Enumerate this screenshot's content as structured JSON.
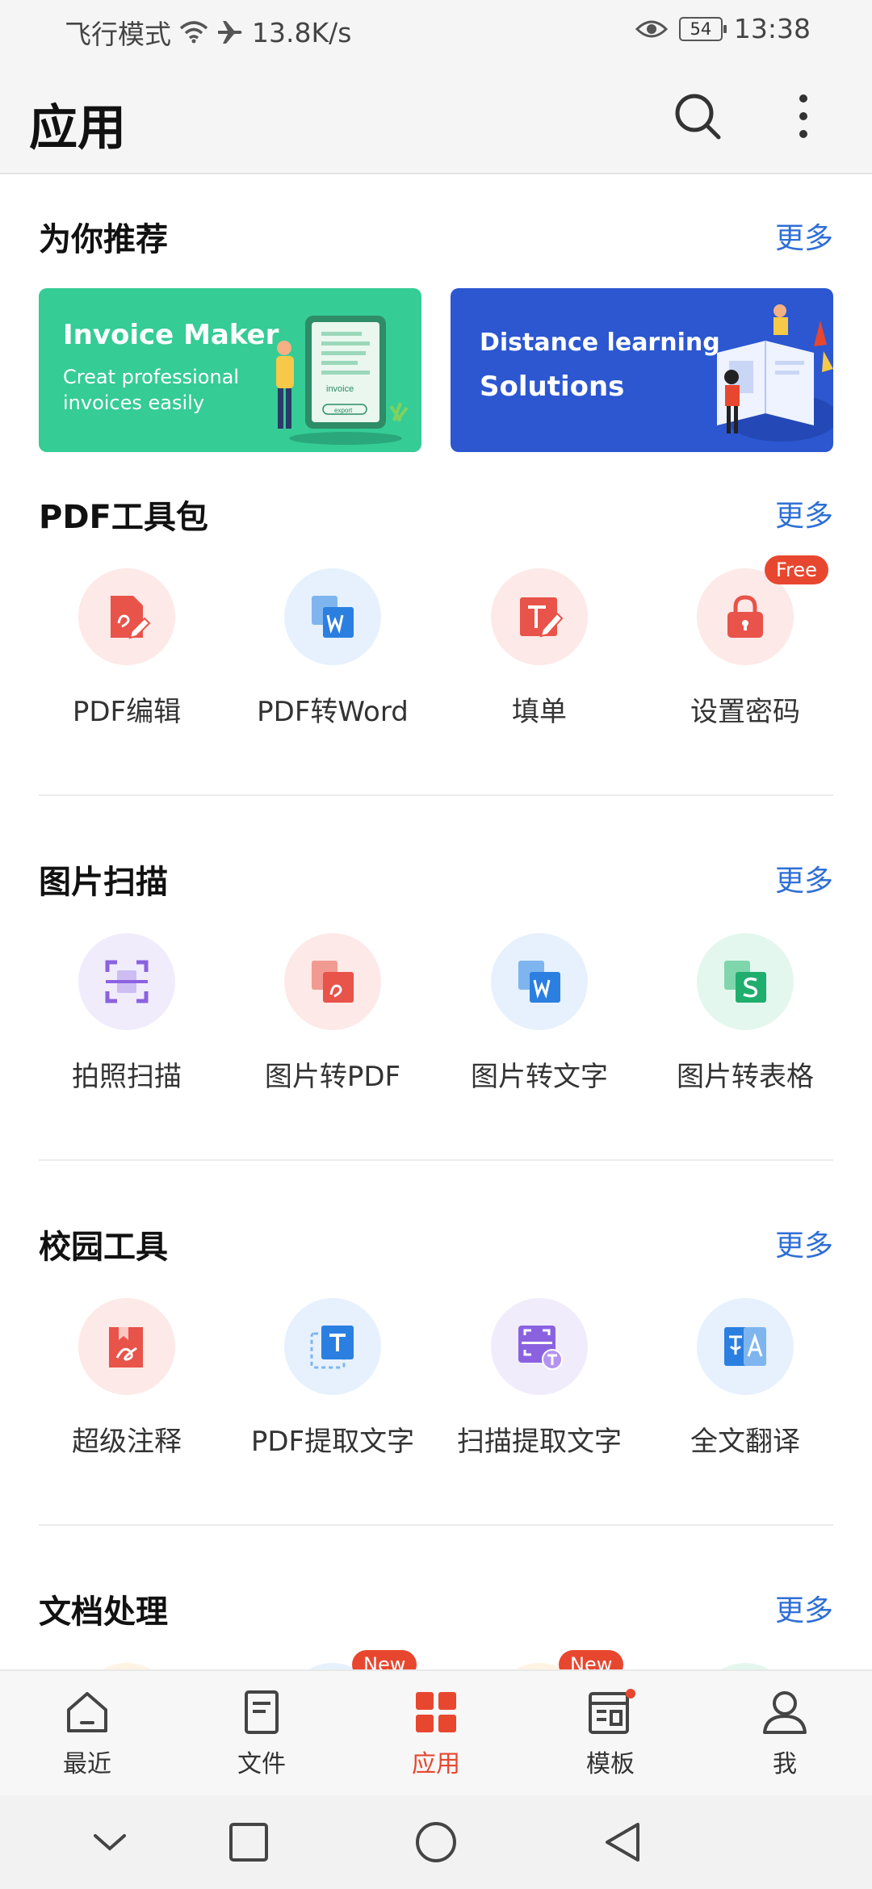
{
  "status_bar": {
    "mode": "飞行模式",
    "speed": "13.8K/s",
    "battery": "54",
    "time": "13:38"
  },
  "header": {
    "title": "应用"
  },
  "recommend": {
    "title": "为你推荐",
    "more": "更多",
    "banners": [
      {
        "line1": "Invoice Maker",
        "line2": "Creat professional",
        "line3": "invoices easily",
        "doc_label": "invoice",
        "doc_button": "export"
      },
      {
        "line1": "Distance learning",
        "line2": "Solutions"
      }
    ]
  },
  "pdf_tools": {
    "title": "PDF工具包",
    "more": "更多",
    "items": [
      {
        "label": "PDF编辑",
        "icon": "pdf-edit-icon"
      },
      {
        "label": "PDF转Word",
        "icon": "pdf-to-word-icon"
      },
      {
        "label": "填单",
        "icon": "fill-form-icon"
      },
      {
        "label": "设置密码",
        "icon": "lock-icon",
        "badge": "Free"
      }
    ]
  },
  "image_scan": {
    "title": "图片扫描",
    "more": "更多",
    "items": [
      {
        "label": "拍照扫描",
        "icon": "camera-scan-icon"
      },
      {
        "label": "图片转PDF",
        "icon": "image-to-pdf-icon"
      },
      {
        "label": "图片转文字",
        "icon": "image-to-text-icon"
      },
      {
        "label": "图片转表格",
        "icon": "image-to-sheet-icon"
      }
    ]
  },
  "campus_tools": {
    "title": "校园工具",
    "more": "更多",
    "items": [
      {
        "label": "超级注释",
        "icon": "super-annotate-icon"
      },
      {
        "label": "PDF提取文字",
        "icon": "pdf-extract-text-icon"
      },
      {
        "label": "扫描提取文字",
        "icon": "scan-extract-text-icon"
      },
      {
        "label": "全文翻译",
        "icon": "translate-icon"
      }
    ]
  },
  "doc_processing": {
    "title": "文档处理",
    "more": "更多",
    "badges": [
      "New",
      "New"
    ]
  },
  "bottom_nav": {
    "items": [
      {
        "label": "最近",
        "icon": "home-icon"
      },
      {
        "label": "文件",
        "icon": "file-icon"
      },
      {
        "label": "应用",
        "icon": "apps-icon"
      },
      {
        "label": "模板",
        "icon": "template-icon"
      },
      {
        "label": "我",
        "icon": "profile-icon"
      }
    ]
  },
  "colors": {
    "accent": "#e8472f",
    "link": "#2f6fd6",
    "green_banner": "#35cc96",
    "blue_banner": "#2c57d0"
  }
}
